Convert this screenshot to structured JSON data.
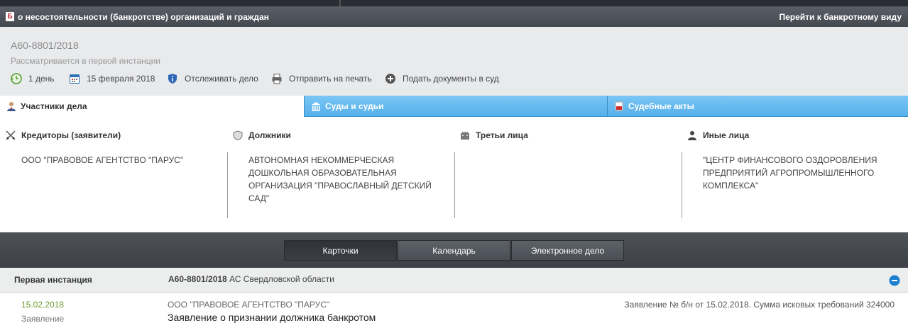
{
  "header": {
    "logo_letter": "Б",
    "title": "о несостоятельности (банкротстве) организаций и граждан",
    "switch_view": "Перейти к банкротному виду"
  },
  "case": {
    "number": "А60-8801/2018",
    "status": "Рассматривается в первой инстанции",
    "actions": [
      {
        "label": "1 день",
        "icon": "clock-back-icon"
      },
      {
        "label": "15 февраля 2018",
        "icon": "calendar-icon"
      },
      {
        "label": "Отслеживать дело",
        "icon": "shield-info-icon"
      },
      {
        "label": "Отправить на печать",
        "icon": "printer-icon"
      },
      {
        "label": "Подать документы в суд",
        "icon": "plus-circle-icon"
      }
    ]
  },
  "tabs": [
    {
      "label": "Участники дела",
      "icon": "person-icon",
      "active": true
    },
    {
      "label": "Суды и судьи",
      "icon": "courthouse-icon",
      "active": false
    },
    {
      "label": "Судебные акты",
      "icon": "pdf-document-icon",
      "active": false
    }
  ],
  "participants": [
    {
      "heading": "Кредиторы (заявители)",
      "icon": "crossed-swords-icon",
      "lines": [
        "ООО \"ПРАВОВОЕ АГЕНТСТВО \"ПАРУС\""
      ]
    },
    {
      "heading": "Должники",
      "icon": "shield-icon",
      "lines": [
        "АВТОНОМНАЯ НЕКОММЕРЧЕСКАЯ",
        "ДОШКОЛЬНАЯ ОБРАЗОВАТЕЛЬНАЯ",
        "ОРГАНИЗАЦИЯ \"ПРАВОСЛАВНЫЙ ДЕТСКИЙ",
        "САД\""
      ]
    },
    {
      "heading": "Третьи лица",
      "icon": "castle-wall-icon",
      "lines": []
    },
    {
      "heading": "Иные лица",
      "icon": "person-silhouette-icon",
      "lines": [
        "\"ЦЕНТР ФИНАНСОВОГО ОЗДОРОВЛЕНИЯ",
        "ПРЕДПРИЯТИЙ АГРОПРОМЫШЛЕННОГО",
        "КОМПЛЕКСА\""
      ]
    }
  ],
  "view_switch": [
    {
      "label": "Карточки",
      "active": true
    },
    {
      "label": "Календарь",
      "active": false
    },
    {
      "label": "Электронное дело",
      "active": false
    }
  ],
  "instance": {
    "name": "Первая инстанция",
    "case_number": "А60-8801/2018",
    "court": " АС Свердловской области"
  },
  "document": {
    "date": "15.02.2018",
    "type": "Заявление",
    "party": "ООО \"ПРАВОВОЕ АГЕНТСТВО \"ПАРУС\"",
    "title": "Заявление о признании должника банкротом",
    "description": "Заявление № б/н от 15.02.2018. Сумма исковых требований 324000"
  },
  "colors": {
    "tab_blue": "#55b0ea",
    "date_green": "#6f9b2e",
    "collapse_blue": "#1b7fd0"
  }
}
